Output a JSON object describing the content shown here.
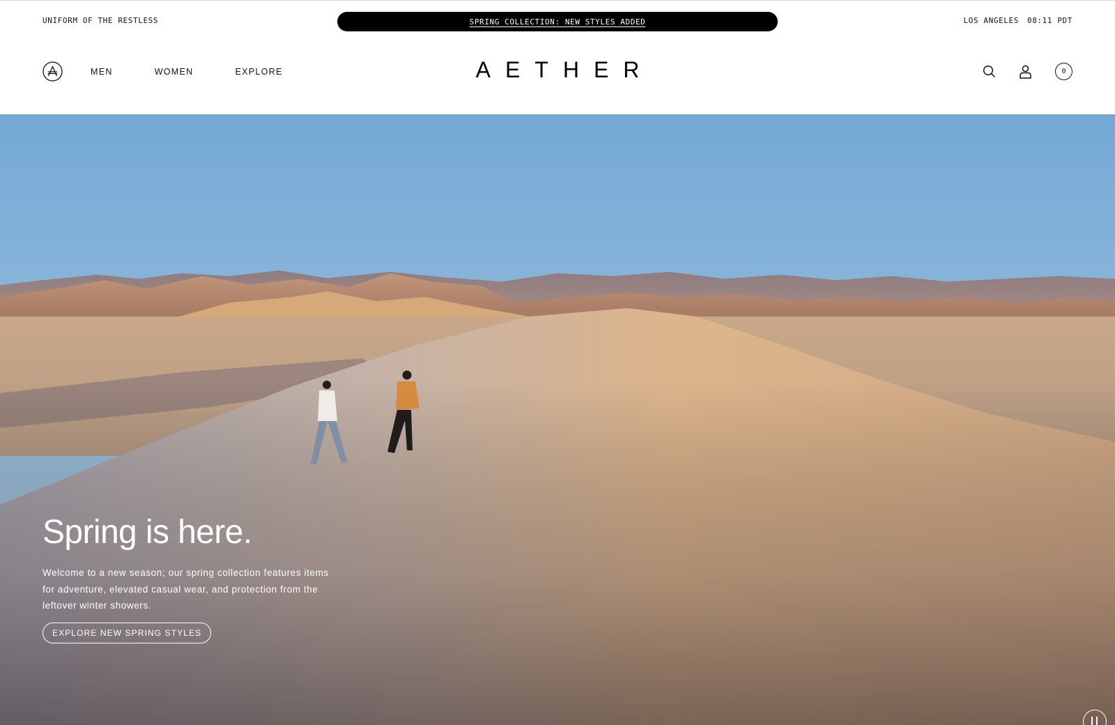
{
  "topbar": {
    "tagline": "UNIFORM OF THE RESTLESS",
    "announcement": "SPRING COLLECTION: NEW STYLES ADDED",
    "location": "LOS ANGELES",
    "time": "08:11 PDT"
  },
  "nav": {
    "items": [
      {
        "label": "MEN"
      },
      {
        "label": "WOMEN"
      },
      {
        "label": "EXPLORE"
      }
    ],
    "brand": "AETHER",
    "cart_count": "0",
    "icons": [
      "brand-a-icon",
      "search-icon",
      "account-icon",
      "cart-icon"
    ]
  },
  "hero": {
    "title": "Spring is here.",
    "body": "Welcome to a new season; our spring collection features items for adventure, elevated casual wear, and protection from the leftover winter showers.",
    "cta": "EXPLORE NEW SPRING STYLES",
    "media_control": "pause-icon"
  },
  "colors": {
    "announcement_bg": "#000000",
    "text": "#111111",
    "sky_top": "#7eb0d8",
    "sand": "#d8b084"
  }
}
